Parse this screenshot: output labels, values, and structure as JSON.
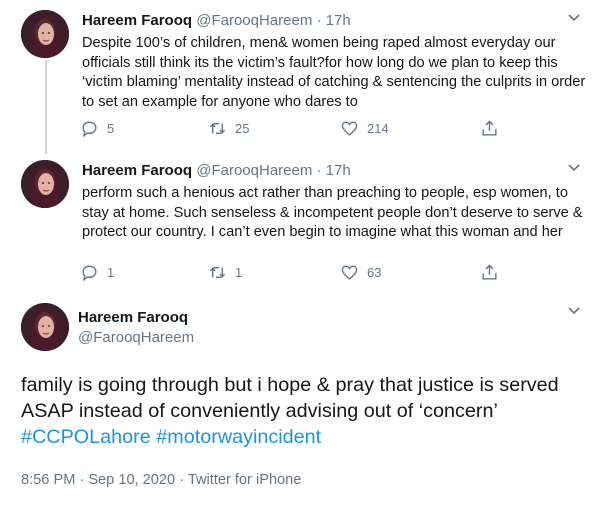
{
  "tweets": [
    {
      "author_name": "Hareem Farooq",
      "handle": "@FarooqHareem",
      "separator": "·",
      "time": "17h",
      "text": "Despite 100’s of children, men& women being raped almost everyday our officials still think its the victim’s fault?for how long do we plan to keep this ‘victim blaming’ mentality instead of catching & sentencing the culprits in order to set an example for anyone who dares to",
      "replies": "5",
      "retweets": "25",
      "likes": "214"
    },
    {
      "author_name": "Hareem Farooq",
      "handle": "@FarooqHareem",
      "separator": "·",
      "time": "17h",
      "text": "perform such a henious act rather than preaching to people, esp women, to stay at home. Such senseless & incompetent people don’t deserve to serve & protect our country. I can’t even begin to imagine what this woman and her",
      "replies": "1",
      "retweets": "1",
      "likes": "63"
    }
  ],
  "main_tweet": {
    "author_name": "Hareem Farooq",
    "handle": "@FarooqHareem",
    "text_plain": "family is going through but i hope & pray that justice is served ASAP instead of conveniently advising out of ‘concern’",
    "hashtags": [
      "#CCPOLahore",
      "#motorwayincident"
    ],
    "timestamp": "8:56 PM · Sep 10, 2020 · Twitter for iPhone"
  },
  "icons": {
    "reply": "reply-icon",
    "retweet": "retweet-icon",
    "like": "heart-icon",
    "share": "share-icon",
    "more": "chevron-down-icon"
  },
  "colors": {
    "text": "#14171a",
    "secondary": "#657786",
    "link": "#1b95e0",
    "thread_line": "#ccd6dd"
  }
}
